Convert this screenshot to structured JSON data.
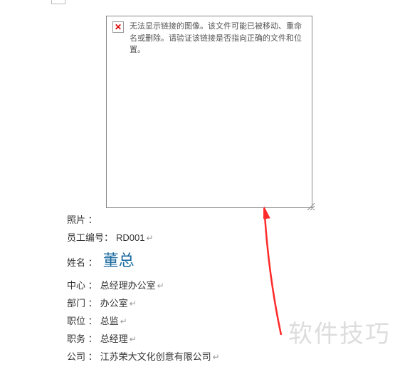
{
  "imageBox": {
    "errorText": "无法显示链接的图像。该文件可能已被移动、重命名或删除。请验证该链接是否指向正确的文件和位置。"
  },
  "fields": {
    "photo": {
      "label": "照片 ："
    },
    "empNo": {
      "label": "员工编号：",
      "value": "RD001"
    },
    "name": {
      "label": "姓名 ：",
      "value": "董总"
    },
    "center": {
      "label": "中心 ：",
      "value": "总经理办公室"
    },
    "dept": {
      "label": "部门 ：",
      "value": "办公室"
    },
    "title": {
      "label": "职位 ：",
      "value": "总监"
    },
    "duty": {
      "label": "职务 ：",
      "value": "总经理"
    },
    "company": {
      "label": "公司 ：",
      "value": "江苏荣大文化创意有限公司"
    }
  },
  "paraMark": "↵",
  "watermark": "软件技巧"
}
